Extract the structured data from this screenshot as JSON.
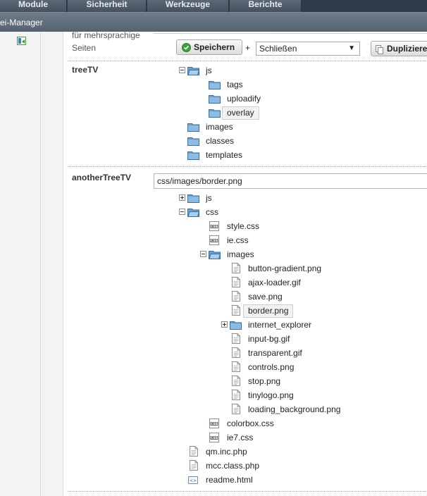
{
  "nav": {
    "tabs": [
      "Module",
      "Sicherheit",
      "Werkzeuge",
      "Berichte"
    ]
  },
  "subbar": {
    "title": "ei-Manager"
  },
  "top": {
    "desc_line1": "für mehrsprachige",
    "desc_line2": "Seiten",
    "save_label": "Speichern",
    "plus": "+",
    "close_select": "Schließen",
    "dup_label": "Duplizieren"
  },
  "treeTV": {
    "label": "treeTV",
    "items": [
      "js",
      "tags",
      "uploadify",
      "overlay",
      "images",
      "classes",
      "templates"
    ]
  },
  "anotherTreeTV": {
    "label": "anotherTreeTV",
    "path_value": "css/images/border.png",
    "items": [
      "js",
      "css",
      "style.css",
      "ie.css",
      "images",
      "button-gradient.png",
      "ajax-loader.gif",
      "save.png",
      "border.png",
      "internet_explorer",
      "input-bg.gif",
      "transparent.gif",
      "controls.png",
      "stop.png",
      "tinylogo.png",
      "loading_background.png",
      "colorbox.css",
      "ie7.css",
      "qm.inc.php",
      "mcc.class.php",
      "readme.html"
    ]
  },
  "icons": [
    "collapse-panel-icon",
    "checkmark-icon",
    "duplicate-icon",
    "folder-icon",
    "folder-open-icon",
    "file-icon",
    "css-file-icon",
    "html-file-icon",
    "expand-toggle-icon",
    "collapse-toggle-icon",
    "dropdown-arrow-icon"
  ],
  "colors": {
    "nav_bg": "#4f5c69",
    "folder": "#5b93c8",
    "save_check": "#3aa23a"
  }
}
